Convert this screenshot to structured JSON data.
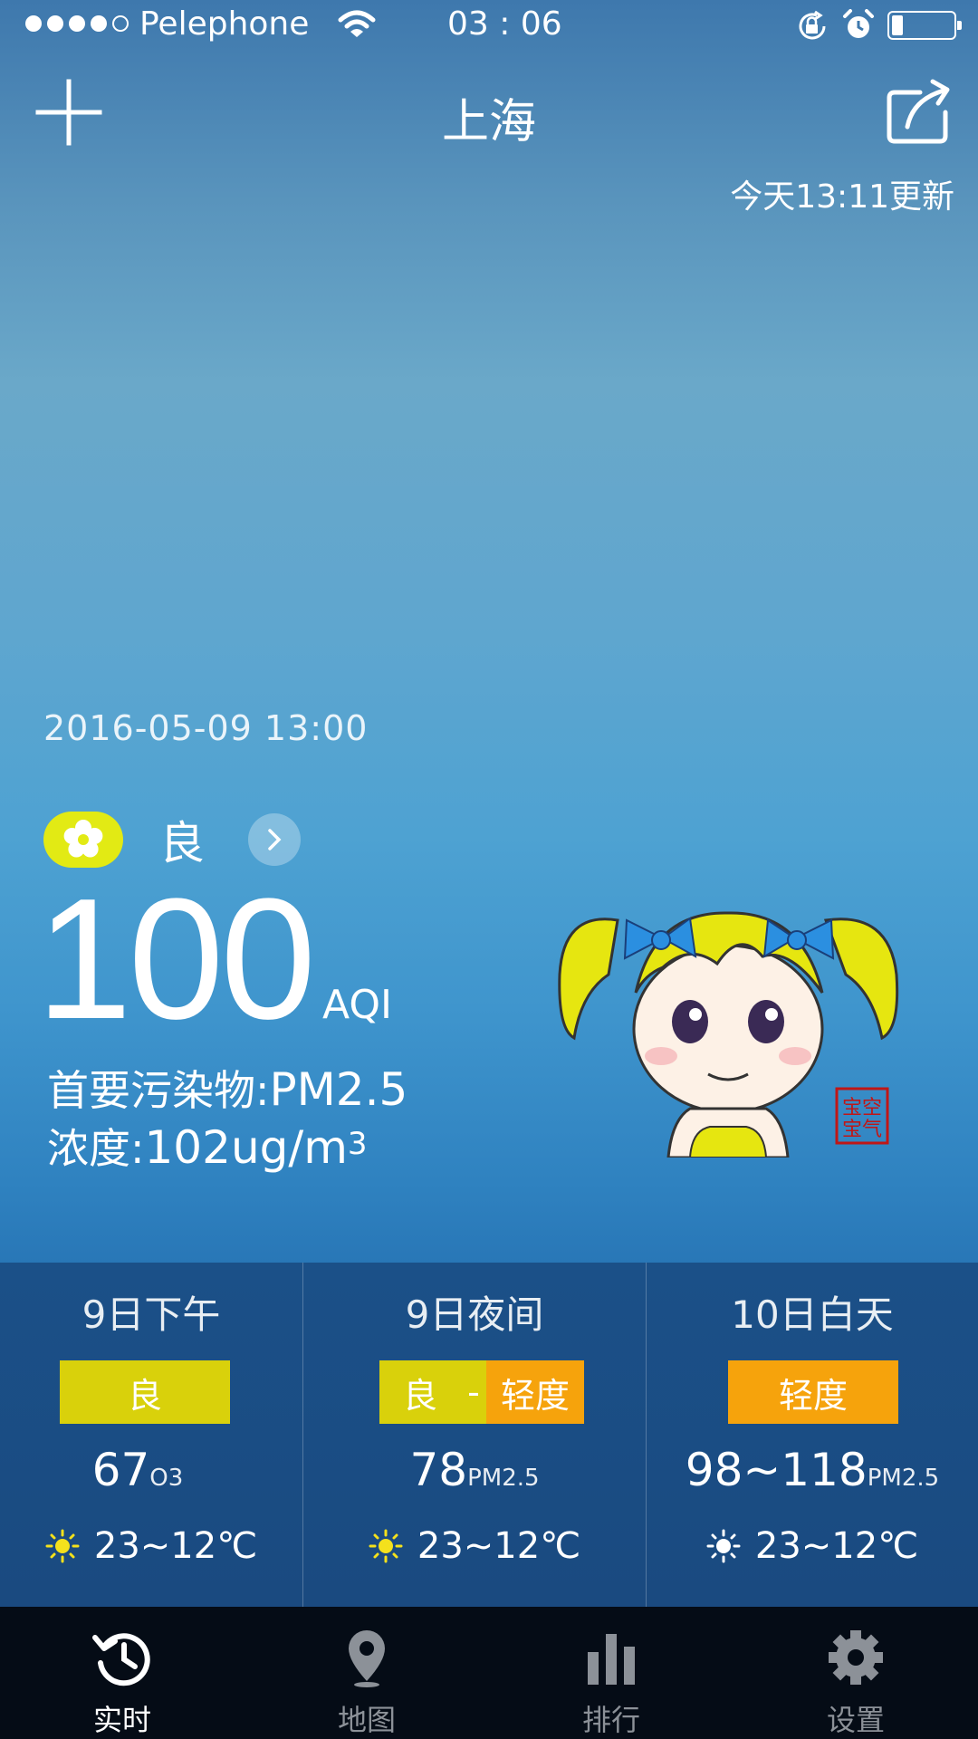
{
  "status_bar": {
    "carrier": "Pelephone",
    "time": "03 : 06"
  },
  "header": {
    "city": "上海",
    "updated": "今天13:11更新"
  },
  "current": {
    "datetime": "2016-05-09  13:00",
    "level": "良",
    "aqi": "100",
    "aqi_unit": "AQI",
    "primary_pollutant_label": "首要污染物:",
    "primary_pollutant": "PM2.5",
    "concentration_label": "浓度:",
    "concentration_value": "102",
    "concentration_unit": "ug/m",
    "concentration_unit_sup": "3"
  },
  "forecast": [
    {
      "title": "9日下午",
      "badge": [
        "良"
      ],
      "value": "67",
      "pollutant": "O3",
      "temp": "23~12℃"
    },
    {
      "title": "9日夜间",
      "badge": [
        "良",
        "-",
        "轻度"
      ],
      "value": "78",
      "pollutant": "PM2.5",
      "temp": "23~12℃"
    },
    {
      "title": "10日白天",
      "badge": [
        "轻度"
      ],
      "value": "98~118",
      "pollutant": "PM2.5",
      "temp": "23~12℃"
    }
  ],
  "tabs": [
    {
      "label": "实时",
      "icon": "history-icon"
    },
    {
      "label": "地图",
      "icon": "map-pin-icon"
    },
    {
      "label": "排行",
      "icon": "bar-chart-icon"
    },
    {
      "label": "设置",
      "icon": "gear-icon"
    }
  ],
  "colors": {
    "good": "#d9d10b",
    "light": "#f6a30c",
    "flower_pill": "#e2ea14"
  },
  "stamp_text": "空气宝宝"
}
